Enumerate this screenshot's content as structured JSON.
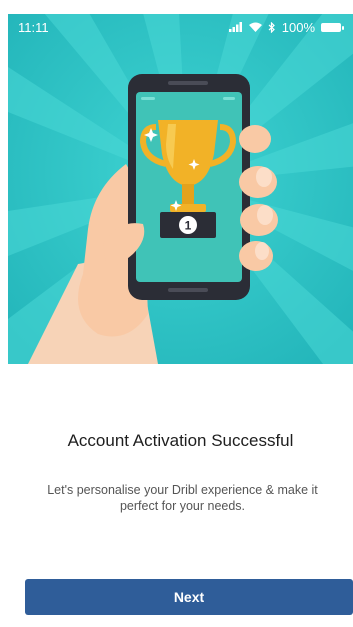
{
  "status_bar": {
    "time": "11:11",
    "battery": "100%",
    "icons": [
      "signal-icon",
      "wifi-icon",
      "bluetooth-icon",
      "battery-icon"
    ]
  },
  "hero": {
    "illustration": "hand-holding-phone-with-trophy",
    "trophy_badge": "1",
    "background_color": "#2ec4c6"
  },
  "content": {
    "title": "Account Activation Successful",
    "subtitle": "Let's personalise your Dribl experience & make it perfect for your needs."
  },
  "actions": {
    "next_label": "Next"
  },
  "colors": {
    "primary_button": "#2f5d99",
    "trophy_gold": "#f2b227"
  }
}
